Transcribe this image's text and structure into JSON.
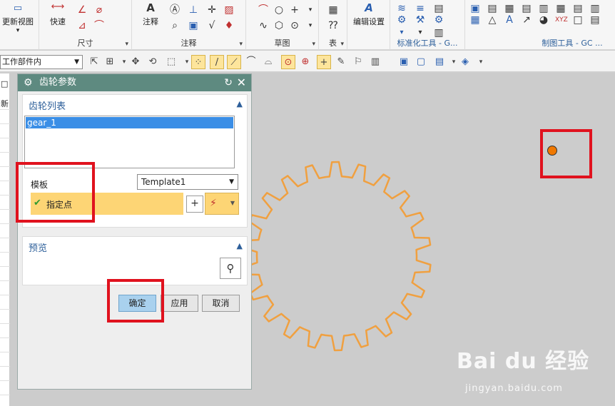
{
  "ribbon": {
    "groups": [
      {
        "label": ""
      },
      {
        "label": "尺寸"
      },
      {
        "label": "注释"
      },
      {
        "label": "草图"
      },
      {
        "label": "表"
      },
      {
        "label": "标准化工具 - G..."
      },
      {
        "label": "制图工具 - GC ..."
      }
    ],
    "update_view_label": "更新视图",
    "quick_label": "快速",
    "annotation_label": "注释",
    "edit_settings_label": "编辑设置"
  },
  "toolbar": {
    "filter_value": "工作部件内"
  },
  "dialog": {
    "title": "齿轮参数",
    "gear_list_title": "齿轮列表",
    "gear_items": [
      "gear_1"
    ],
    "template_label": "模板",
    "template_value": "Template1",
    "specify_point_label": "指定点",
    "preview_title": "预览",
    "ok_label": "确定",
    "apply_label": "应用",
    "cancel_label": "取消"
  },
  "left_panel": {
    "tab_label": "新"
  },
  "watermark": {
    "main": "Bai du 经验",
    "sub": "jingyan.baidu.com"
  },
  "colors": {
    "dialog_title_bar": "#5e8a80",
    "gear_outline": "#f0a040",
    "point_marker": "#f07800",
    "highlight_box": "#e0121e",
    "selected_row": "#fdd575"
  }
}
